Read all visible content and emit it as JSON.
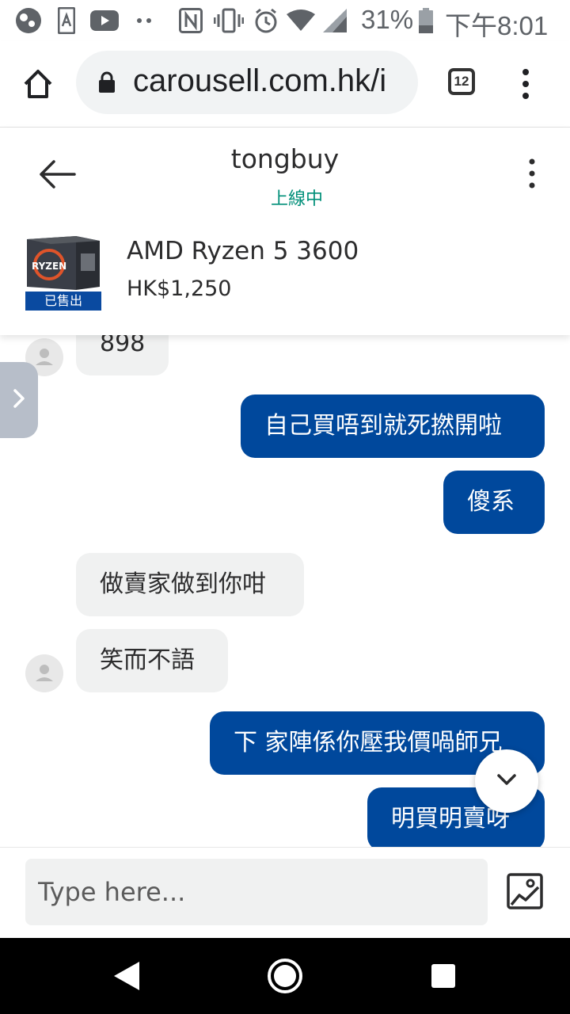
{
  "status_bar": {
    "battery": "31%",
    "time": "下午8:01"
  },
  "browser": {
    "url": "carousell.com.hk/i",
    "tab_count": "12"
  },
  "chat": {
    "username": "tongbuy",
    "online_status": "上線中",
    "product": {
      "title": "AMD Ryzen 5 3600",
      "price": "HK$1,250",
      "sold_label": "已售出",
      "thumb_text": "RYZEN"
    },
    "messages": [
      {
        "side": "in",
        "text": "898"
      },
      {
        "side": "out",
        "text": "自己買唔到就死撚開啦"
      },
      {
        "side": "out",
        "text": "傻系"
      },
      {
        "side": "in",
        "text": "做賣家做到你咁"
      },
      {
        "side": "in",
        "text": "笑而不語"
      },
      {
        "side": "out",
        "text": "下 家陣係你壓我價喎師兄"
      },
      {
        "side": "out",
        "text": "明買明賣呀"
      }
    ]
  },
  "composer": {
    "placeholder": "Type here..."
  },
  "colors": {
    "outgoing_bubble": "#00489c",
    "incoming_bubble": "#f0f1f1",
    "online": "#008f79",
    "sold_label": "#0a4aa0"
  },
  "icons": {
    "status": [
      "app-icon",
      "android-icon",
      "youtube-icon",
      "more-dots-icon",
      "nfc-icon",
      "vibrate-icon",
      "alarm-icon",
      "wifi-icon",
      "signal-icon",
      "battery-icon"
    ],
    "browser": [
      "home-icon",
      "lock-icon",
      "tab-switcher-icon",
      "menu-icon"
    ],
    "chat": [
      "back-arrow-icon",
      "overflow-menu-icon",
      "chevron-right-icon",
      "chevron-down-icon",
      "image-upload-icon"
    ],
    "nav": [
      "back-triangle-icon",
      "home-circle-icon",
      "recents-square-icon"
    ]
  }
}
